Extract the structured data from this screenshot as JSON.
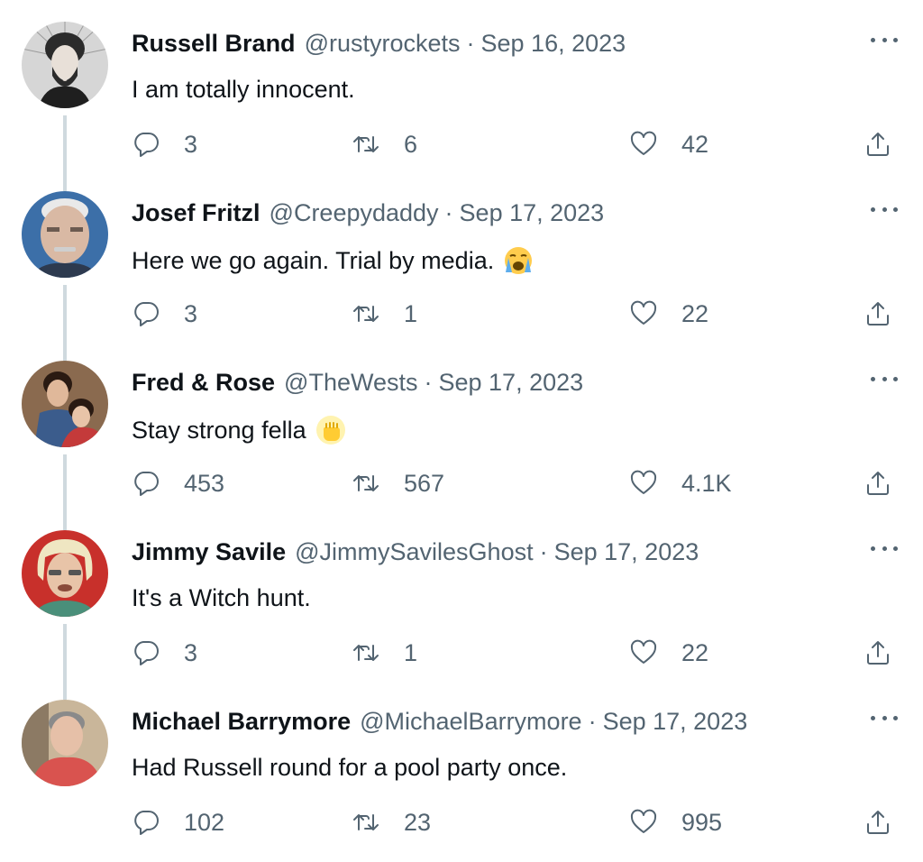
{
  "tweets": [
    {
      "name": "Russell Brand",
      "handle": "@rustyrockets",
      "separator": "·",
      "date": "Sep 16, 2023",
      "text": "I am totally innocent.",
      "emoji": "",
      "replies": "3",
      "retweets": "6",
      "likes": "42",
      "avatar_colors": [
        "#d9d9d9",
        "#3a3a3a"
      ]
    },
    {
      "name": "Josef Fritzl",
      "handle": "@Creepydaddy",
      "separator": "·",
      "date": "Sep 17, 2023",
      "text": "Here we go again. Trial by media.",
      "emoji": "loudly-crying-face",
      "replies": "3",
      "retweets": "1",
      "likes": "22",
      "avatar_colors": [
        "#3c6fa8",
        "#d7b9a3"
      ]
    },
    {
      "name": "Fred & Rose",
      "handle": "@TheWests",
      "separator": "·",
      "date": "Sep 17, 2023",
      "text": "Stay strong fella",
      "emoji": "raised-fist",
      "replies": "453",
      "retweets": "567",
      "likes": "4.1K",
      "avatar_colors": [
        "#6b4a35",
        "#c43a3a"
      ]
    },
    {
      "name": "Jimmy Savile",
      "handle": "@JimmySavilesGhost",
      "separator": "·",
      "date": "Sep 17, 2023",
      "text": "It's a Witch hunt.",
      "emoji": "",
      "replies": "3",
      "retweets": "1",
      "likes": "22",
      "avatar_colors": [
        "#c8302b",
        "#efe6c2"
      ]
    },
    {
      "name": "Michael Barrymore",
      "handle": "@MichaelBarrymore",
      "separator": "·",
      "date": "Sep 17, 2023",
      "text": "Had Russell round for a pool party once.",
      "emoji": "",
      "replies": "102",
      "retweets": "23",
      "likes": "995",
      "avatar_colors": [
        "#c9b69a",
        "#d9534f"
      ]
    }
  ],
  "colors": {
    "text": "#0f1419",
    "secondary": "#536471",
    "thread_line": "#cfd9de"
  },
  "icons": [
    "reply-icon",
    "retweet-icon",
    "like-icon",
    "share-icon",
    "more-icon"
  ]
}
